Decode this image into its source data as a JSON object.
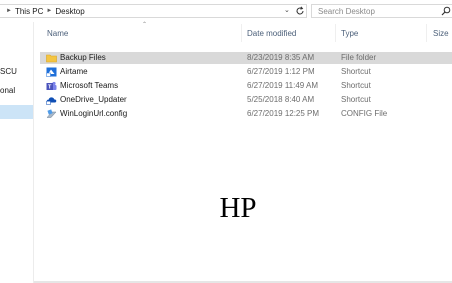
{
  "address_bar": {
    "path": [
      "This PC",
      "Desktop"
    ],
    "search_placeholder": "Search Desktop"
  },
  "nav_pane": {
    "items": [
      {
        "label": "SCU",
        "selected": false
      },
      {
        "label": "onal",
        "selected": false
      },
      {
        "label": "",
        "selected": true
      }
    ]
  },
  "columns": {
    "name": "Name",
    "date": "Date modified",
    "type": "Type",
    "size": "Size"
  },
  "files": [
    {
      "name": "Backup Files",
      "date": "8/23/2019 8:35 AM",
      "type": "File folder",
      "icon": "folder-icon",
      "selected": true
    },
    {
      "name": "Airtame",
      "date": "6/27/2019 1:12 PM",
      "type": "Shortcut",
      "icon": "airtame-icon",
      "selected": false
    },
    {
      "name": "Microsoft Teams",
      "date": "6/27/2019 11:49 AM",
      "type": "Shortcut",
      "icon": "teams-icon",
      "selected": false
    },
    {
      "name": "OneDrive_Updater",
      "date": "5/25/2018 8:40 AM",
      "type": "Shortcut",
      "icon": "onedrive-icon",
      "selected": false
    },
    {
      "name": "WinLoginUrl.config",
      "date": "6/27/2019 12:25 PM",
      "type": "CONFIG File",
      "icon": "config-file-icon",
      "selected": false
    }
  ],
  "overlay_text": "HP",
  "colors": {
    "selection": "#d9d9d9",
    "nav_selection": "#cce4f7",
    "header_text": "#4c607a",
    "folder": "#f4c542"
  }
}
